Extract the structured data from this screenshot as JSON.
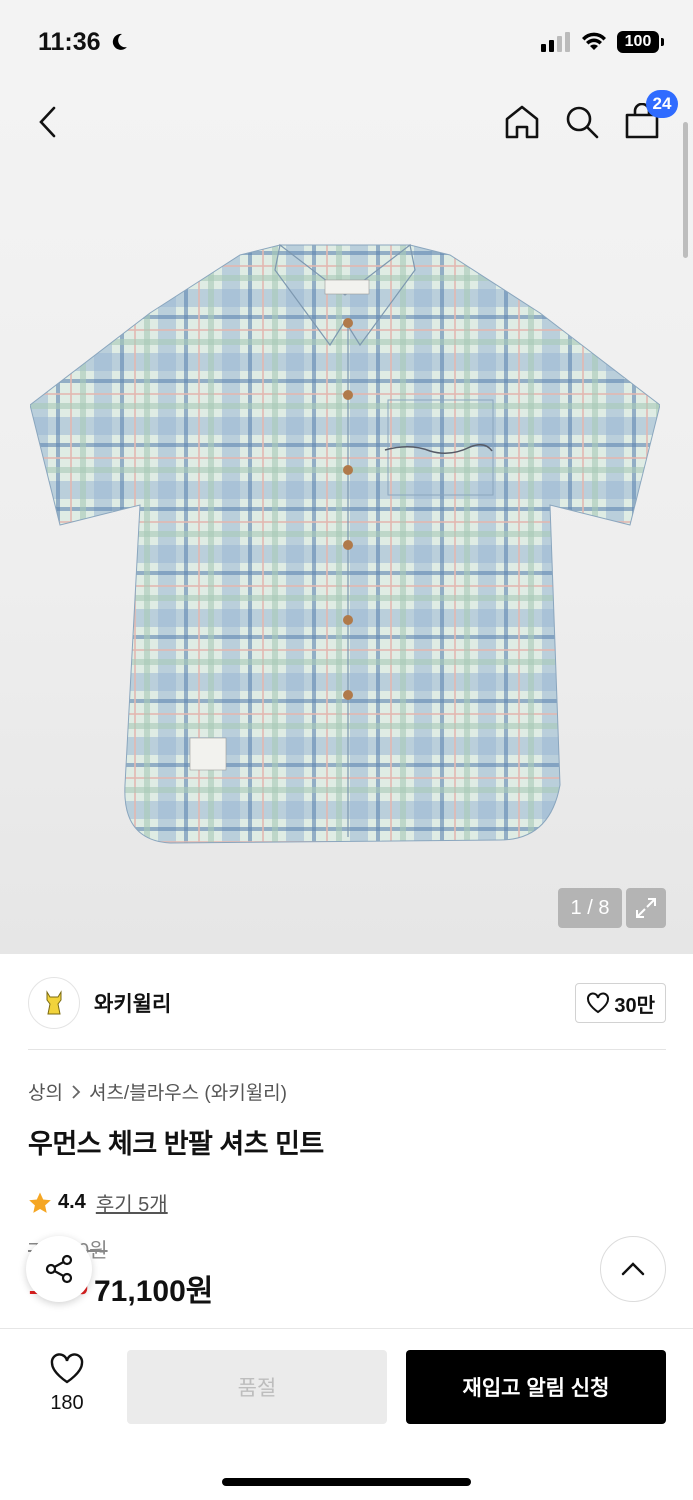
{
  "status_bar": {
    "time": "11:36",
    "battery": "100"
  },
  "header": {
    "cart_count": "24"
  },
  "gallery": {
    "counter": "1 / 8"
  },
  "brand": {
    "name": "와키윌리",
    "likes": "30만"
  },
  "breadcrumb": {
    "category": "상의",
    "subcategory": "셔츠/블라우스 (와키윌리)"
  },
  "product": {
    "title": "우먼스 체크 반팔 셔츠 민트",
    "rating": "4.4",
    "reviews": "후기 5개",
    "original_price": "79,000원",
    "discount": "10%",
    "price": "71,100원"
  },
  "bottom_bar": {
    "wish_count": "180",
    "soldout_label": "품절",
    "notify_label": "재입고 알림 신청"
  },
  "colors": {
    "accent": "#2f6bff",
    "discount": "#e02020",
    "star": "#f5a623",
    "primary_button": "#000000"
  }
}
